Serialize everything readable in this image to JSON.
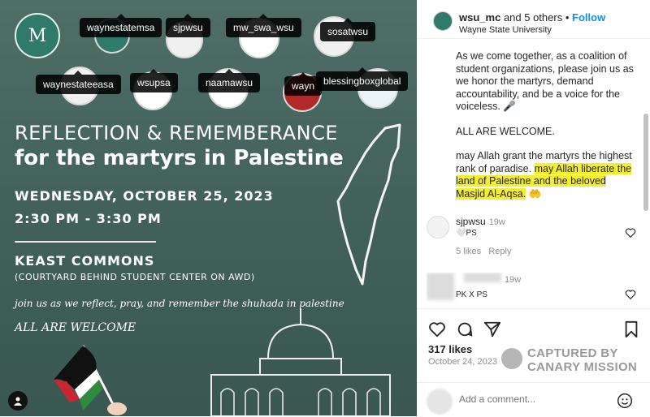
{
  "post_image": {
    "tags": [
      "waynestatemsa",
      "sjpwsu",
      "mw_swa_wsu",
      "sosatwsu",
      "waynestateeasa",
      "wsupsa",
      "naamawsu",
      "wayn",
      "blessingboxglobal"
    ],
    "headline1": "REFLECTION & REMEMBERANCE",
    "headline2": "for the martyrs in Palestine",
    "date": "WEDNESDAY, OCTOBER 25, 2023",
    "time": "2:30 PM - 3:30 PM",
    "venue": "KEAST COMMONS",
    "venue_sub": "(COURTYARD BEHIND STUDENT CENTER ON AWD)",
    "join": "join us as we reflect, pray, and remember the shuhada in palestine",
    "welcome": "ALL ARE WELCOME",
    "logo_text": "M"
  },
  "header": {
    "username": "wsu_mc",
    "and_others": "and 5 others",
    "separator": "•",
    "follow": "Follow",
    "location": "Wayne State University"
  },
  "caption": {
    "para1": "As we come together, as a coalition of student organizations, please join us as we honor the martyrs, demand accountability, and be a voice for the voiceless. 🎤",
    "para2": "ALL ARE WELCOME.",
    "para3_plain": "may Allah grant the martyrs the highest rank of paradise. ",
    "para3_highlight": "may Allah liberate the land of Palestine and the beloved Masjid Al-Aqsa.",
    "para3_emoji": "🤲"
  },
  "comments": [
    {
      "user": "sjpwsu",
      "time": "19w",
      "text": "PS",
      "likes": "5 likes",
      "reply": "Reply"
    },
    {
      "user": "",
      "time": "19w",
      "text": "PK X PS",
      "likes": "",
      "reply": ""
    }
  ],
  "footer": {
    "likes": "317 likes",
    "date": "October 24, 2023",
    "watermark_line1": "CAPTURED BY",
    "watermark_line2": "CANARY MISSION",
    "add_comment_placeholder": "Add a comment..."
  },
  "colors": {
    "image_bg": "#4e6e66",
    "follow": "#0095f6",
    "highlight": "#f3ee2e"
  }
}
